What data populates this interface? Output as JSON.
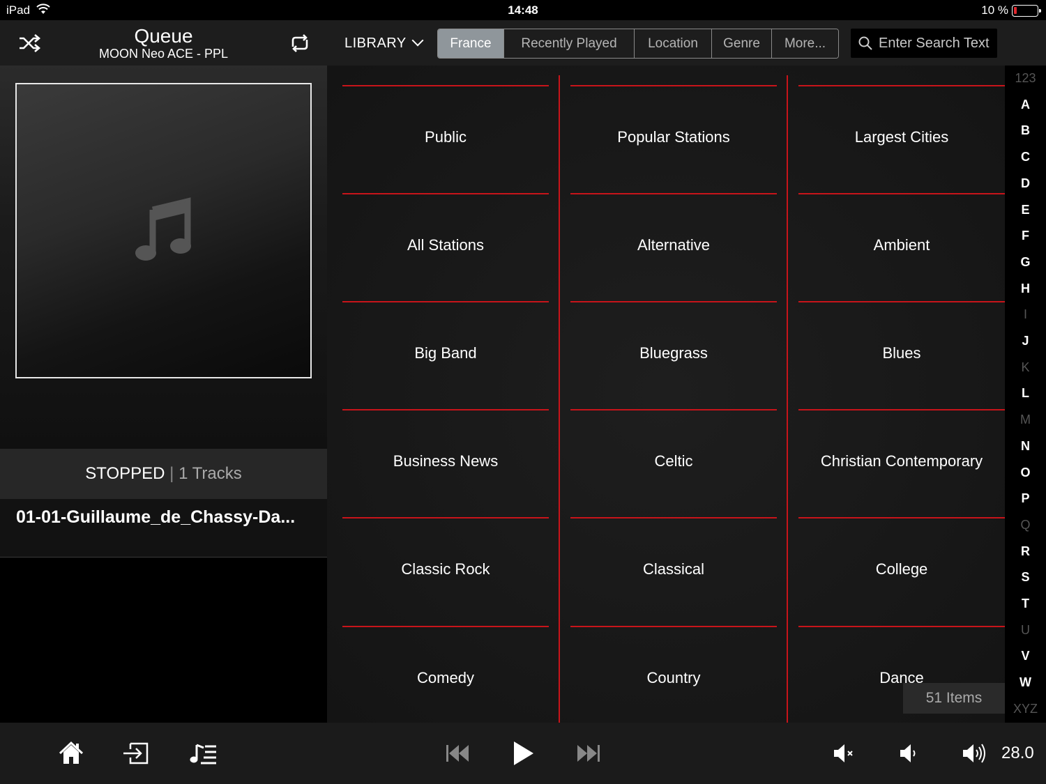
{
  "status_bar": {
    "device": "iPad",
    "time": "14:48",
    "battery": "10 %",
    "battery_level": 0.1
  },
  "queue": {
    "title": "Queue",
    "subtitle": "MOON Neo ACE - PPL",
    "state": "STOPPED",
    "separator": "|",
    "tracks": "1 Tracks",
    "current_track": "01-01-Guillaume_de_Chassy-Da..."
  },
  "library": {
    "label": "LIBRARY",
    "tabs": [
      "France",
      "Recently Played",
      "Location",
      "Genre",
      "More..."
    ],
    "active_tab": "France",
    "search_placeholder": "Enter Search Text",
    "items": [
      "Public",
      "Popular Stations",
      "Largest Cities",
      "All Stations",
      "Alternative",
      "Ambient",
      "Big Band",
      "Bluegrass",
      "Blues",
      "Business News",
      "Celtic",
      "Christian Contemporary",
      "Classic Rock",
      "Classical",
      "College",
      "Comedy",
      "Country",
      "Dance"
    ],
    "item_count": "51 Items"
  },
  "alpha_index": [
    {
      "l": "123",
      "dim": true
    },
    {
      "l": "A"
    },
    {
      "l": "B"
    },
    {
      "l": "C"
    },
    {
      "l": "D"
    },
    {
      "l": "E"
    },
    {
      "l": "F"
    },
    {
      "l": "G"
    },
    {
      "l": "H"
    },
    {
      "l": "I",
      "dim": true
    },
    {
      "l": "J"
    },
    {
      "l": "K",
      "dim": true
    },
    {
      "l": "L"
    },
    {
      "l": "M",
      "dim": true
    },
    {
      "l": "N"
    },
    {
      "l": "O"
    },
    {
      "l": "P"
    },
    {
      "l": "Q",
      "dim": true
    },
    {
      "l": "R"
    },
    {
      "l": "S"
    },
    {
      "l": "T"
    },
    {
      "l": "U",
      "dim": true
    },
    {
      "l": "V"
    },
    {
      "l": "W"
    },
    {
      "l": "XYZ",
      "dim": true
    }
  ],
  "icons": {
    "shuffle": "shuffle-icon",
    "repeat": "repeat-icon",
    "home": "home-icon",
    "input": "input-icon",
    "playlist": "playlist-icon",
    "previous": "previous-icon",
    "play": "play-icon",
    "next": "next-icon",
    "mute": "mute-icon",
    "volume_down": "volume-down-icon",
    "volume_up": "volume-up-icon",
    "search": "search-icon"
  },
  "volume": "28.0",
  "colors": {
    "accent": "#c8141a",
    "active_tab": "#8f969b"
  }
}
